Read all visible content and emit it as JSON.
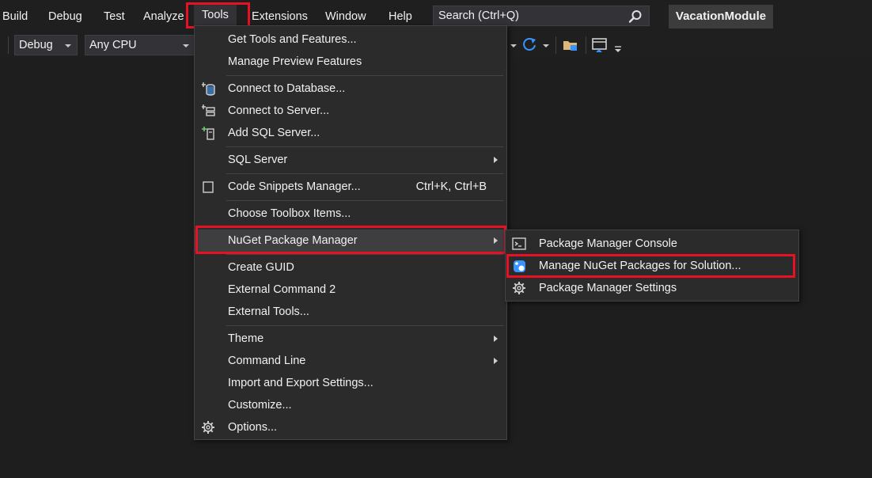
{
  "menubar": {
    "items": [
      "Build",
      "Debug",
      "Test",
      "Analyze",
      "Tools",
      "Extensions",
      "Window",
      "Help"
    ],
    "search_placeholder": "Search (Ctrl+Q)",
    "solution_name": "VacationModule"
  },
  "toolbar": {
    "configuration": "Debug",
    "platform": "Any CPU"
  },
  "tools_menu": {
    "items": [
      {
        "label": "Get Tools and Features...",
        "icon": ""
      },
      {
        "label": "Manage Preview Features",
        "icon": ""
      },
      {
        "label": "Connect to Database...",
        "icon": "database-connect-icon"
      },
      {
        "label": "Connect to Server...",
        "icon": "server-connect-icon"
      },
      {
        "label": "Add SQL Server...",
        "icon": "add-sql-server-icon"
      },
      {
        "label": "SQL Server",
        "icon": "",
        "submenu": true
      },
      {
        "label": "Code Snippets Manager...",
        "icon": "code-snippets-icon",
        "shortcut": "Ctrl+K, Ctrl+B"
      },
      {
        "label": "Choose Toolbox Items...",
        "icon": ""
      },
      {
        "label": "NuGet Package Manager",
        "icon": "",
        "submenu": true,
        "active": true
      },
      {
        "label": "Create GUID",
        "icon": ""
      },
      {
        "label": "External Command 2",
        "icon": ""
      },
      {
        "label": "External Tools...",
        "icon": ""
      },
      {
        "label": "Theme",
        "icon": "",
        "submenu": true
      },
      {
        "label": "Command Line",
        "icon": "",
        "submenu": true
      },
      {
        "label": "Import and Export Settings...",
        "icon": ""
      },
      {
        "label": "Customize...",
        "icon": ""
      },
      {
        "label": "Options...",
        "icon": "gear-icon"
      }
    ]
  },
  "nuget_submenu": {
    "items": [
      {
        "label": "Package Manager Console",
        "icon": "console-icon"
      },
      {
        "label": "Manage NuGet Packages for Solution...",
        "icon": "nuget-icon",
        "highlighted": true
      },
      {
        "label": "Package Manager Settings",
        "icon": "gear-icon"
      }
    ]
  },
  "colors": {
    "highlight": "#e81123",
    "menu_bg": "#2b2b2b",
    "background": "#1e1e1e",
    "active_item": "#3e3e40"
  }
}
